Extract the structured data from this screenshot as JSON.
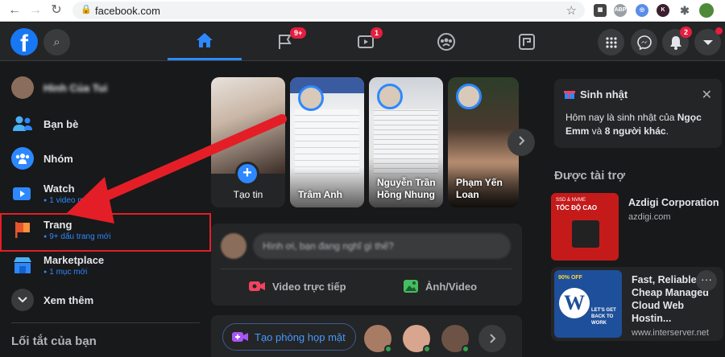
{
  "browser": {
    "url": "facebook.com",
    "extensions": [
      "ABP",
      "K"
    ]
  },
  "topnav": {
    "pages_badge": "9+",
    "watch_badge": "1",
    "notifications_badge": "2"
  },
  "sidebar": {
    "profile_name": "Hình Của Tui",
    "items": [
      {
        "label": "Bạn bè",
        "sub": ""
      },
      {
        "label": "Nhóm",
        "sub": ""
      },
      {
        "label": "Watch",
        "sub": "1 video mới"
      },
      {
        "label": "Trang",
        "sub": "9+ dấu trang mới"
      },
      {
        "label": "Marketplace",
        "sub": "1 mục mới"
      },
      {
        "label": "Xem thêm",
        "sub": ""
      }
    ],
    "shortcuts_title": "Lối tắt của bạn"
  },
  "stories": [
    {
      "name": "Tạo tin"
    },
    {
      "name": "Trâm Anh"
    },
    {
      "name": "Nguyễn Trần Hồng Nhung"
    },
    {
      "name": "Phạm Yến Loan"
    }
  ],
  "composer": {
    "placeholder": "Hình ơi, bạn đang nghĩ gì thế?",
    "live_label": "Video trực tiếp",
    "photo_label": "Ảnh/Video"
  },
  "rooms": {
    "create_label": "Tạo phòng họp mặt"
  },
  "birthday": {
    "title": "Sinh nhật",
    "text_prefix": "Hôm nay là sinh nhật của ",
    "name": "Ngọc Emm",
    "text_mid": " và ",
    "others": "8 người khác",
    "text_suffix": "."
  },
  "sponsored": {
    "title": "Được tài trợ",
    "ads": [
      {
        "name": "Azdigi Corporation",
        "domain": "azdigi.com",
        "img_heading": "SSD & NVME",
        "img_sub": "TỐC ĐỘ CAO"
      },
      {
        "name": "Fast, Reliable & Cheap Managed Cloud Web Hostin...",
        "domain": "www.interserver.net",
        "img_heading": "90% OFF",
        "img_sub": "LET'S GET BACK TO WORK"
      }
    ]
  },
  "colors": {
    "accent": "#2d88ff",
    "badge": "#e41e3f",
    "highlight": "#e41e27",
    "bg": "#18191a",
    "card": "#242526"
  }
}
